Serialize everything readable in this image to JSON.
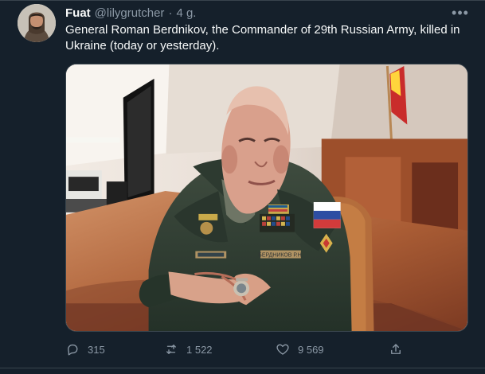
{
  "tweet": {
    "author_name": "Fuat",
    "author_handle": "@lilygrutcher",
    "separator": "·",
    "time": "4 g.",
    "more_label": "•••",
    "text": "General Roman Berdnikov, the Commander of 29th Russian Army, killed in Ukraine (today or yesterday).",
    "uniform_tag": "БЕРДНИКОВ Р.Н.",
    "actions": {
      "replies": "315",
      "retweets": "1 522",
      "likes": "9 569",
      "share": ""
    }
  },
  "colors": {
    "background": "#15202b",
    "text": "#f7f9f9",
    "muted": "#8b98a5",
    "border": "#38444d"
  },
  "icons": [
    "avatar",
    "more-icon",
    "reply-icon",
    "retweet-icon",
    "like-icon",
    "share-icon"
  ]
}
